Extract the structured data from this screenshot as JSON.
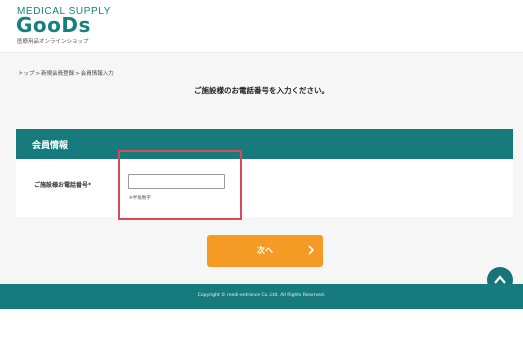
{
  "header": {
    "logo_top": "MEDICAL SUPPLY",
    "logo_main": "GooDs",
    "logo_sub": "医療用品オンラインショップ"
  },
  "breadcrumb": {
    "items": [
      "トップ",
      "新規会員登録",
      "会員情報入力"
    ],
    "separator": ">"
  },
  "page": {
    "heading": "ご施設様のお電話番号を入力ください。"
  },
  "panel": {
    "title": "会員情報",
    "field_label": "ご施設様お電話番号*",
    "input_value": "",
    "input_placeholder": "",
    "hint": "※半角数字"
  },
  "actions": {
    "next_label": "次へ",
    "next_icon": "chevron-right-icon",
    "scroll_top_icon": "chevron-up-icon"
  },
  "footer": {
    "copyright": "Copyright © medi-entrance Co.,Ltd. All Rights Reserved."
  },
  "colors": {
    "brand_teal": "#177b7e",
    "button_orange": "#f59a25",
    "highlight_red": "#d84a5a",
    "background_grey": "#f6f6f6"
  }
}
